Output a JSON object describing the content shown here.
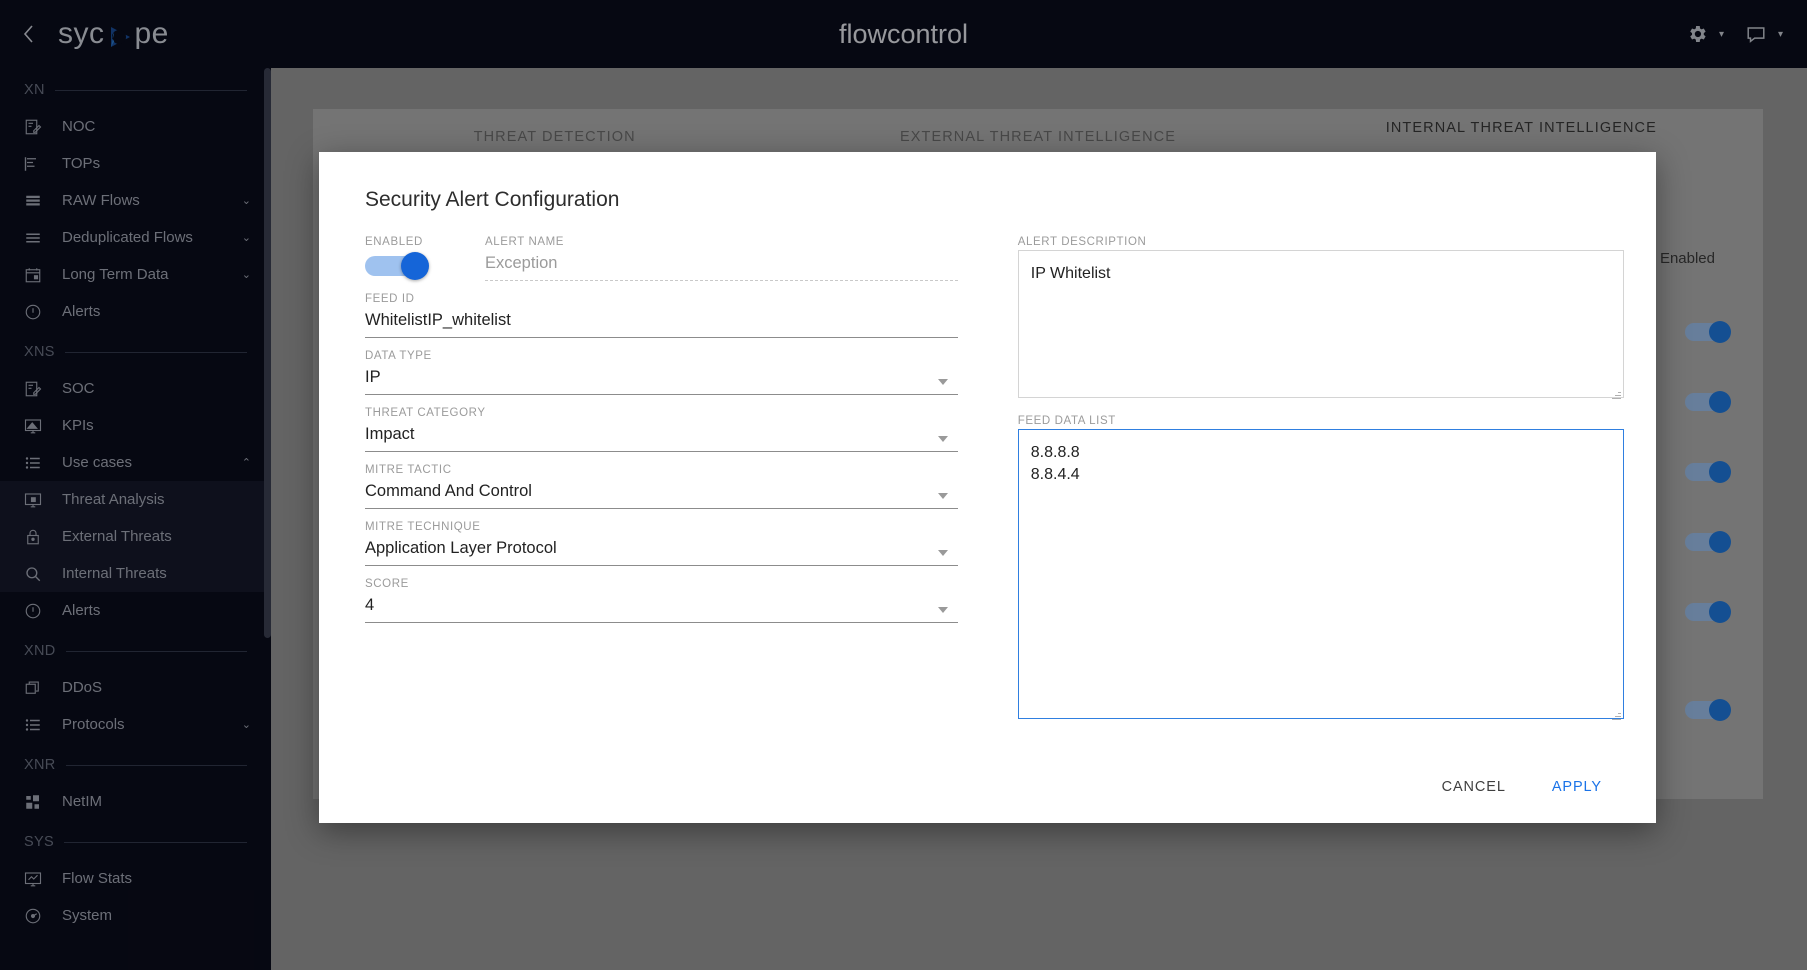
{
  "topbar": {
    "back_icon": "chevron-left-icon",
    "brand": {
      "part1": "syc",
      "part2": "pe"
    },
    "app_title": "flowcontrol",
    "settings_icon": "gear-icon",
    "settings_caret": "▾",
    "comment_icon": "comment-icon",
    "comment_caret": "▾"
  },
  "sidebar": {
    "groups": [
      {
        "label": "XN",
        "items": [
          {
            "label": "NOC",
            "icon": "noc-icon",
            "chevron": ""
          },
          {
            "label": "TOPs",
            "icon": "tops-icon",
            "chevron": ""
          },
          {
            "label": "RAW Flows",
            "icon": "rows-icon",
            "chevron": "⌄"
          },
          {
            "label": "Deduplicated Flows",
            "icon": "lines-icon",
            "chevron": "⌄"
          },
          {
            "label": "Long Term Data",
            "icon": "calendar-icon",
            "chevron": "⌄"
          },
          {
            "label": "Alerts",
            "icon": "alert-icon",
            "chevron": ""
          }
        ]
      },
      {
        "label": "XNS",
        "items": [
          {
            "label": "SOC",
            "icon": "soc-icon",
            "chevron": ""
          },
          {
            "label": "KPIs",
            "icon": "monitor-icon",
            "chevron": ""
          },
          {
            "label": "Use cases",
            "icon": "list-icon",
            "chevron": "⌃"
          },
          {
            "label": "Threat Analysis",
            "icon": "monitor-lock-icon",
            "chevron": ""
          },
          {
            "label": "External Threats",
            "icon": "lock-icon",
            "chevron": ""
          },
          {
            "label": "Internal Threats",
            "icon": "search-icon",
            "chevron": ""
          },
          {
            "label": "Alerts",
            "icon": "alert-icon",
            "chevron": ""
          }
        ]
      },
      {
        "label": "XND",
        "items": [
          {
            "label": "DDoS",
            "icon": "layers-icon",
            "chevron": ""
          },
          {
            "label": "Protocols",
            "icon": "list-icon",
            "chevron": "⌄"
          }
        ]
      },
      {
        "label": "XNR",
        "items": [
          {
            "label": "NetIM",
            "icon": "grid-icon",
            "chevron": ""
          }
        ]
      },
      {
        "label": "SYS",
        "items": [
          {
            "label": "Flow Stats",
            "icon": "chart-monitor-icon",
            "chevron": ""
          },
          {
            "label": "System",
            "icon": "system-icon",
            "chevron": ""
          }
        ]
      }
    ]
  },
  "background": {
    "tabs": [
      {
        "label": "THREAT DETECTION",
        "active": false
      },
      {
        "label": "EXTERNAL THREAT INTELLIGENCE",
        "active": false
      },
      {
        "label": "INTERNAL THREAT INTELLIGENCE",
        "active": true
      }
    ],
    "table_header": "Enabled",
    "toggle_count": 6
  },
  "modal": {
    "title": "Security Alert Configuration",
    "enabled": {
      "label": "ENABLED",
      "on": true
    },
    "alert_name": {
      "label": "ALERT NAME",
      "value": "Exception",
      "disabled": true
    },
    "feed_id": {
      "label": "FEED ID",
      "value": "WhitelistIP_whitelist"
    },
    "data_type": {
      "label": "DATA TYPE",
      "value": "IP"
    },
    "threat_category": {
      "label": "THREAT CATEGORY",
      "value": "Impact"
    },
    "mitre_tactic": {
      "label": "MITRE TACTIC",
      "value": "Command And Control"
    },
    "mitre_technique": {
      "label": "MITRE TECHNIQUE",
      "value": "Application Layer Protocol"
    },
    "score": {
      "label": "SCORE",
      "value": "4"
    },
    "alert_description": {
      "label": "ALERT DESCRIPTION",
      "value": "IP Whitelist"
    },
    "feed_data_list": {
      "label": "FEED DATA LIST",
      "value": "8.8.8.8\n8.8.4.4"
    },
    "cancel_label": "CANCEL",
    "apply_label": "APPLY"
  },
  "colors": {
    "accent_blue": "#1a73e8",
    "toggle_on": "#1565d8",
    "sidebar_bg": "#0a0d1c",
    "focus_border": "#2f7fe0"
  }
}
